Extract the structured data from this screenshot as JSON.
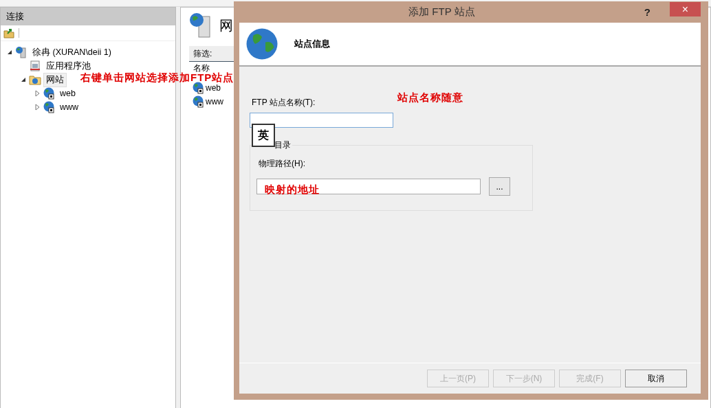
{
  "connections": {
    "title": "连接",
    "tree": [
      {
        "label": "徐冉 (XURAN\\deii 1)",
        "kind": "server",
        "expanded": true,
        "selected": false,
        "children": [
          {
            "label": "应用程序池",
            "kind": "pool",
            "selected": false
          },
          {
            "label": "网站",
            "kind": "sites",
            "expanded": true,
            "selected": true,
            "children": [
              {
                "label": "web",
                "kind": "site",
                "expanded": false,
                "selected": false
              },
              {
                "label": "www",
                "kind": "site",
                "expanded": false,
                "selected": false
              }
            ]
          }
        ]
      }
    ]
  },
  "sites_panel": {
    "title": "网",
    "filter_label": "筛选:",
    "column": "名称",
    "rows": [
      "web",
      "www"
    ]
  },
  "dialog": {
    "title": "添加 FTP 站点",
    "help": "?",
    "close": "×",
    "header": "站点信息",
    "name_label": "FTP 站点名称(T):",
    "group_label": "目录",
    "path_label": "物理路径(H):",
    "browse": "...",
    "buttons": [
      {
        "label": "上一页(P)",
        "disabled": true
      },
      {
        "label": "下一步(N)",
        "disabled": true
      },
      {
        "label": "完成(F)",
        "disabled": true
      },
      {
        "label": "取消",
        "disabled": false
      }
    ]
  },
  "ime_indicator": "英",
  "annotations": [
    {
      "text": "右键单击网站选择添加FTP站点"
    },
    {
      "text": "站点名称随意"
    },
    {
      "text": "映射的地址"
    }
  ]
}
